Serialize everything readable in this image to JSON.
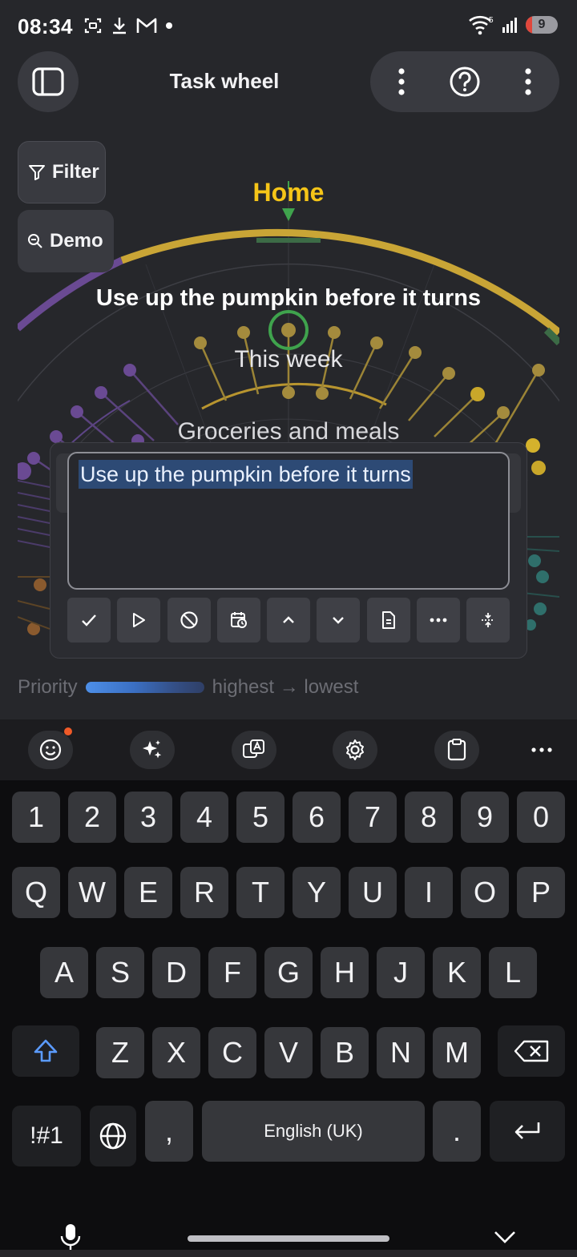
{
  "status_bar": {
    "time": "08:34",
    "battery": "9",
    "signal_badge": "5"
  },
  "header": {
    "title": "Task wheel"
  },
  "chips": {
    "filter": "Filter",
    "demo": "Demo"
  },
  "wheel": {
    "ring_label": "Home",
    "selected_task": "Use up the pumpkin before it turns",
    "group_label": "This week",
    "category_label": "Groceries and meals",
    "colors": {
      "home": "#c9a536",
      "purple": "#6a4a93",
      "selected_ring": "#3fa34d"
    }
  },
  "editor": {
    "value": "Use up the pumpkin before it turns"
  },
  "priority": {
    "label": "Priority",
    "range": "highest → lowest"
  },
  "keyboard": {
    "row_numbers": [
      "1",
      "2",
      "3",
      "4",
      "5",
      "6",
      "7",
      "8",
      "9",
      "0"
    ],
    "row1": [
      "Q",
      "W",
      "E",
      "R",
      "T",
      "Y",
      "U",
      "I",
      "O",
      "P"
    ],
    "row2": [
      "A",
      "S",
      "D",
      "F",
      "G",
      "H",
      "J",
      "K",
      "L"
    ],
    "row3": [
      "Z",
      "X",
      "C",
      "V",
      "B",
      "N",
      "M"
    ],
    "symbols": "!#1",
    "comma": ",",
    "space": "English (UK)",
    "period": "."
  }
}
